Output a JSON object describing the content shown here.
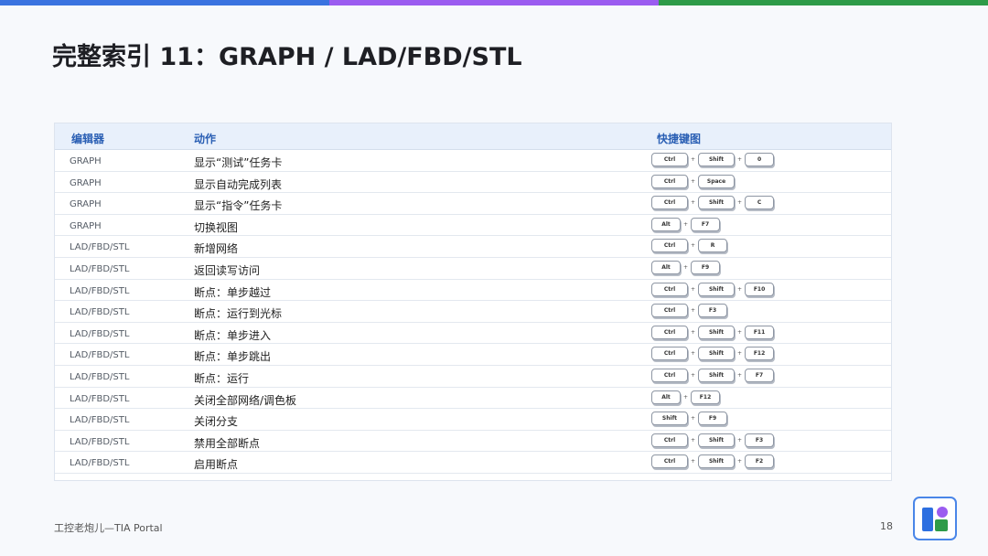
{
  "title": "完整索引 11：GRAPH / LAD/FBD/STL",
  "colors": {
    "bar_blue": "#3a73e0",
    "bar_purple": "#9b5cf0",
    "bar_green": "#2e9b48",
    "header_text": "#2a5fb4",
    "logo_blue": "#2d6fe0",
    "logo_purple": "#9b5cf0",
    "logo_green": "#2e9b48"
  },
  "table": {
    "headers": [
      "编辑器",
      "动作",
      "快捷键图"
    ],
    "rows": [
      {
        "editor": "GRAPH",
        "action": "显示“测试”任务卡",
        "keys": [
          "Ctrl",
          "Shift",
          "0"
        ]
      },
      {
        "editor": "GRAPH",
        "action": "显示自动完成列表",
        "keys": [
          "Ctrl",
          "Space"
        ]
      },
      {
        "editor": "GRAPH",
        "action": "显示“指令”任务卡",
        "keys": [
          "Ctrl",
          "Shift",
          "C"
        ]
      },
      {
        "editor": "GRAPH",
        "action": "切换视图",
        "keys": [
          "Alt",
          "F7"
        ]
      },
      {
        "editor": "LAD/FBD/STL",
        "action": "新增网络",
        "keys": [
          "Ctrl",
          "R"
        ]
      },
      {
        "editor": "LAD/FBD/STL",
        "action": "返回读写访问",
        "keys": [
          "Alt",
          "F9"
        ]
      },
      {
        "editor": "LAD/FBD/STL",
        "action": "断点：单步越过",
        "keys": [
          "Ctrl",
          "Shift",
          "F10"
        ]
      },
      {
        "editor": "LAD/FBD/STL",
        "action": "断点：运行到光标",
        "keys": [
          "Ctrl",
          "F3"
        ]
      },
      {
        "editor": "LAD/FBD/STL",
        "action": "断点：单步进入",
        "keys": [
          "Ctrl",
          "Shift",
          "F11"
        ]
      },
      {
        "editor": "LAD/FBD/STL",
        "action": "断点：单步跳出",
        "keys": [
          "Ctrl",
          "Shift",
          "F12"
        ]
      },
      {
        "editor": "LAD/FBD/STL",
        "action": "断点：运行",
        "keys": [
          "Ctrl",
          "Shift",
          "F7"
        ]
      },
      {
        "editor": "LAD/FBD/STL",
        "action": "关闭全部网络/调色板",
        "keys": [
          "Alt",
          "F12"
        ]
      },
      {
        "editor": "LAD/FBD/STL",
        "action": "关闭分支",
        "keys": [
          "Shift",
          "F9"
        ]
      },
      {
        "editor": "LAD/FBD/STL",
        "action": "禁用全部断点",
        "keys": [
          "Ctrl",
          "Shift",
          "F3"
        ]
      },
      {
        "editor": "LAD/FBD/STL",
        "action": "启用断点",
        "keys": [
          "Ctrl",
          "Shift",
          "F2"
        ]
      }
    ]
  },
  "footer": {
    "left": "工控老炮儿—TIA Portal",
    "page": "18"
  },
  "key_separator": "+"
}
